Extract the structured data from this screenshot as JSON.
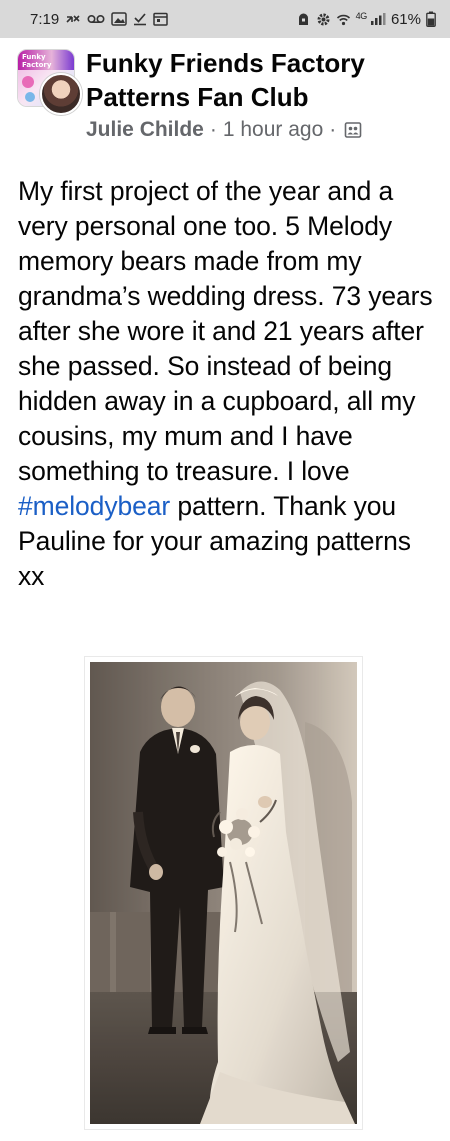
{
  "status_bar": {
    "time": "7:19",
    "network": "4G",
    "battery": "61%"
  },
  "post": {
    "group_name": "Funky Friends Factory Patterns Fan Club",
    "author": "Julie Childe",
    "separator": "·",
    "timestamp": "1 hour ago",
    "text_parts": {
      "before_hashtag": "My first project of the year and a very personal one too. 5 Melody memory bears made from my grandma’s wedding dress. 73 years after she wore it and 21 years after she passed. So instead of being hidden away in a cupboard, all my cousins, my mum and I have something to treasure. I love ",
      "hashtag": "#melodybear",
      "after_hashtag": " pattern. Thank you Pauline for your amazing patterns xx"
    },
    "photo": {
      "kind": "vintage wedding photograph, sepia"
    }
  },
  "icons": {
    "status_left": [
      "missed-call-icon",
      "voicemail-icon",
      "gallery-icon",
      "download-done-icon",
      "calendar-icon"
    ],
    "status_right": [
      "alarm-icon",
      "settings-icon",
      "wifi-icon",
      "signal-icon",
      "battery-icon"
    ],
    "privacy": "members-icon"
  },
  "colors": {
    "status_bar_bg": "#d9d9d9",
    "text": "#050505",
    "meta_text": "#65676b",
    "hashtag": "#1b5fc6"
  }
}
